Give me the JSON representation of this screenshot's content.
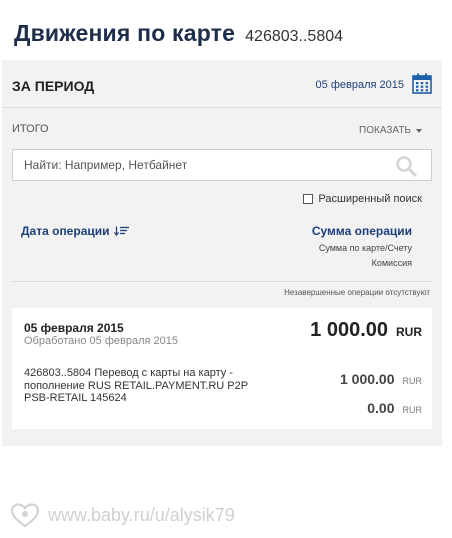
{
  "header": {
    "title": "Движения по карте",
    "card_number": "426803..5804"
  },
  "period": {
    "label": "ЗА ПЕРИОД",
    "date": "05 февраля 2015",
    "calendar_icon": "calendar-icon"
  },
  "summary": {
    "total_label": "ИТОГО",
    "show_label": "ПОКАЗАТЬ"
  },
  "search": {
    "placeholder": "Найти: Например, Нетбайнет",
    "value": "",
    "icon": "search-icon"
  },
  "advanced_search": {
    "label": "Расширенный поиск",
    "checked": false
  },
  "columns": {
    "date": "Дата операции",
    "sum": "Сумма операции",
    "sum_sub": "Сумма по карте/Счету",
    "commission": "Комиссия"
  },
  "pending_text": "Незавершенные операции отсутствуют",
  "operation": {
    "date": "05 февраля 2015",
    "processed": "Обработано 05 февраля 2015",
    "total_amount": "1 000.00",
    "total_currency": "RUR",
    "description": "426803..5804 Перевод с карты на карту - пополнение RUS RETAIL.PAYMENT.RU P2P PSB-RETAIL 145624",
    "card_amount": "1 000.00",
    "card_currency": "RUR",
    "commission_amount": "0.00",
    "commission_currency": "RUR"
  },
  "watermark": {
    "text": "www.baby.ru/u/alysik79"
  },
  "colors": {
    "title": "#1d2d4a",
    "link": "#1d3f7a",
    "panel": "#f2f2f2"
  }
}
